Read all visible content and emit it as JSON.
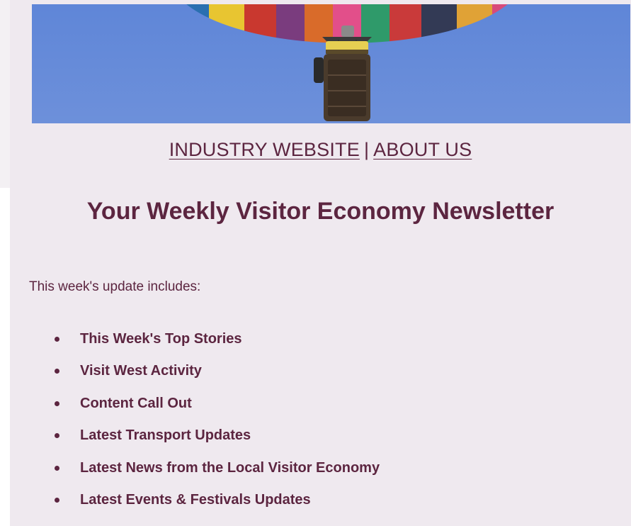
{
  "hero": {
    "image": "hot-air-balloon-blue-sky"
  },
  "nav": {
    "link1": "INDUSTRY WEBSITE",
    "separator": "|",
    "link2": "ABOUT US"
  },
  "title": "Your Weekly Visitor Economy Newsletter",
  "intro": "This week's update includes:",
  "items": [
    "This Week's Top Stories",
    "Visit West Activity",
    "Content Call Out",
    "Latest Transport Updates",
    "Latest News from the Local Visitor Economy",
    "Latest Events & Festivals Updates"
  ],
  "colors": {
    "text": "#5c2540",
    "background": "#efe9ef",
    "sky": "#6a8fd9"
  }
}
